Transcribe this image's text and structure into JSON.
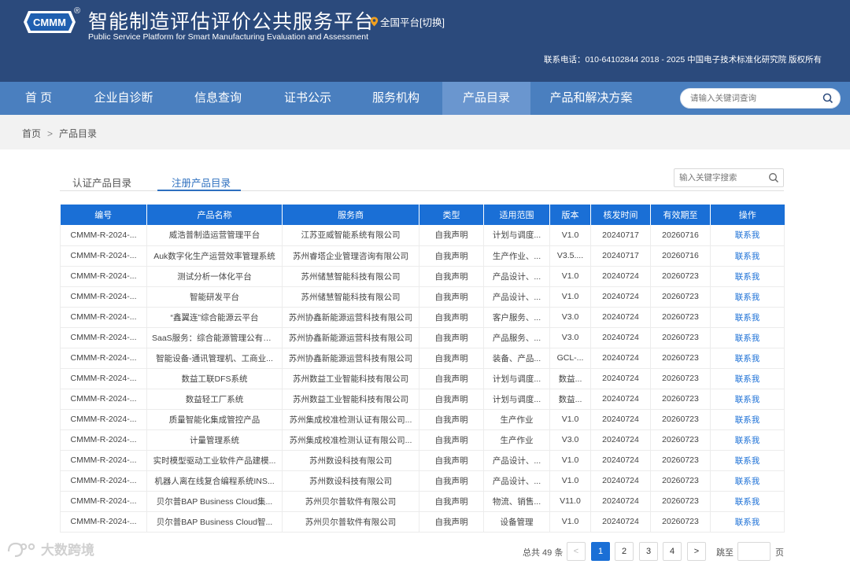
{
  "header": {
    "logo_text": "CMMM",
    "logo_reg": "®",
    "title": "智能制造评估评价公共服务平台",
    "subtitle": "Public Service Platform for Smart Manufacturing Evaluation and Assessment",
    "region": "全国平台[切换]",
    "contact": "联系电话：010-64102844  2018 - 2025 中国电子技术标准化研究院 版权所有"
  },
  "nav": {
    "items": [
      "首 页",
      "企业自诊断",
      "信息查询",
      "证书公示",
      "服务机构",
      "产品目录",
      "产品和解决方案"
    ],
    "active_index": 5,
    "search_placeholder": "请输入关键词查询"
  },
  "breadcrumb": {
    "home": "首页",
    "sep": ">",
    "current": "产品目录"
  },
  "tabs": {
    "items": [
      "认证产品目录",
      "注册产品目录"
    ],
    "active_index": 1
  },
  "keyword_search": {
    "placeholder": "输入关键字搜索"
  },
  "table": {
    "headers": [
      "编号",
      "产品名称",
      "服务商",
      "类型",
      "适用范围",
      "版本",
      "核发时间",
      "有效期至",
      "操作"
    ],
    "rows": [
      [
        "CMMM-R-2024-...",
        "威浩普制造运营管理平台",
        "江苏亚威智能系统有限公司",
        "自我声明",
        "计划与调度...",
        "V1.0",
        "20240717",
        "20260716",
        "联系我"
      ],
      [
        "CMMM-R-2024-...",
        "Auk数字化生产运营效率管理系统",
        "苏州睿塔企业管理咨询有限公司",
        "自我声明",
        "生产作业、...",
        "V3.5....",
        "20240717",
        "20260716",
        "联系我"
      ],
      [
        "CMMM-R-2024-...",
        "测试分析一体化平台",
        "苏州储慧智能科技有限公司",
        "自我声明",
        "产品设计、...",
        "V1.0",
        "20240724",
        "20260723",
        "联系我"
      ],
      [
        "CMMM-R-2024-...",
        "智能研发平台",
        "苏州储慧智能科技有限公司",
        "自我声明",
        "产品设计、...",
        "V1.0",
        "20240724",
        "20260723",
        "联系我"
      ],
      [
        "CMMM-R-2024-...",
        "“鑫翼连”综合能源云平台",
        "苏州协鑫新能源运营科技有限公司",
        "自我声明",
        "客户服务、...",
        "V3.0",
        "20240724",
        "20260723",
        "联系我"
      ],
      [
        "CMMM-R-2024-...",
        "SaaS服务：综合能源管理公有云...",
        "苏州协鑫新能源运营科技有限公司",
        "自我声明",
        "产品服务、...",
        "V3.0",
        "20240724",
        "20260723",
        "联系我"
      ],
      [
        "CMMM-R-2024-...",
        "智能设备-通讯管理机、工商业...",
        "苏州协鑫新能源运营科技有限公司",
        "自我声明",
        "装备、产品...",
        "GCL-...",
        "20240724",
        "20260723",
        "联系我"
      ],
      [
        "CMMM-R-2024-...",
        "数益工联DFS系统",
        "苏州数益工业智能科技有限公司",
        "自我声明",
        "计划与调度...",
        "数益...",
        "20240724",
        "20260723",
        "联系我"
      ],
      [
        "CMMM-R-2024-...",
        "数益轻工厂系统",
        "苏州数益工业智能科技有限公司",
        "自我声明",
        "计划与调度...",
        "数益...",
        "20240724",
        "20260723",
        "联系我"
      ],
      [
        "CMMM-R-2024-...",
        "质量智能化集成管控产品",
        "苏州集成校准检测认证有限公司...",
        "自我声明",
        "生产作业",
        "V1.0",
        "20240724",
        "20260723",
        "联系我"
      ],
      [
        "CMMM-R-2024-...",
        "计量管理系统",
        "苏州集成校准检测认证有限公司...",
        "自我声明",
        "生产作业",
        "V3.0",
        "20240724",
        "20260723",
        "联系我"
      ],
      [
        "CMMM-R-2024-...",
        "实时模型驱动工业软件产品建模...",
        "苏州数设科技有限公司",
        "自我声明",
        "产品设计、...",
        "V1.0",
        "20240724",
        "20260723",
        "联系我"
      ],
      [
        "CMMM-R-2024-...",
        "机器人离在线复合编程系统INS...",
        "苏州数设科技有限公司",
        "自我声明",
        "产品设计、...",
        "V1.0",
        "20240724",
        "20260723",
        "联系我"
      ],
      [
        "CMMM-R-2024-...",
        "贝尔普BAP Business Cloud集...",
        "苏州贝尔普软件有限公司",
        "自我声明",
        "物流、销售...",
        "V11.0",
        "20240724",
        "20260723",
        "联系我"
      ],
      [
        "CMMM-R-2024-...",
        "贝尔普BAP Business Cloud智...",
        "苏州贝尔普软件有限公司",
        "自我声明",
        "设备管理",
        "V1.0",
        "20240724",
        "20260723",
        "联系我"
      ]
    ]
  },
  "pagination": {
    "total_text": "总共 49 条",
    "prev": "<",
    "next": ">",
    "pages": [
      "1",
      "2",
      "3",
      "4"
    ],
    "current_page": 1,
    "jump_label": "跳至",
    "jump_unit": "页"
  },
  "watermark": {
    "text": "大数跨境"
  },
  "colors": {
    "header_bg": "#2b4a7c",
    "nav_bg": "#4a7fbf",
    "accent": "#1a6fd6"
  }
}
